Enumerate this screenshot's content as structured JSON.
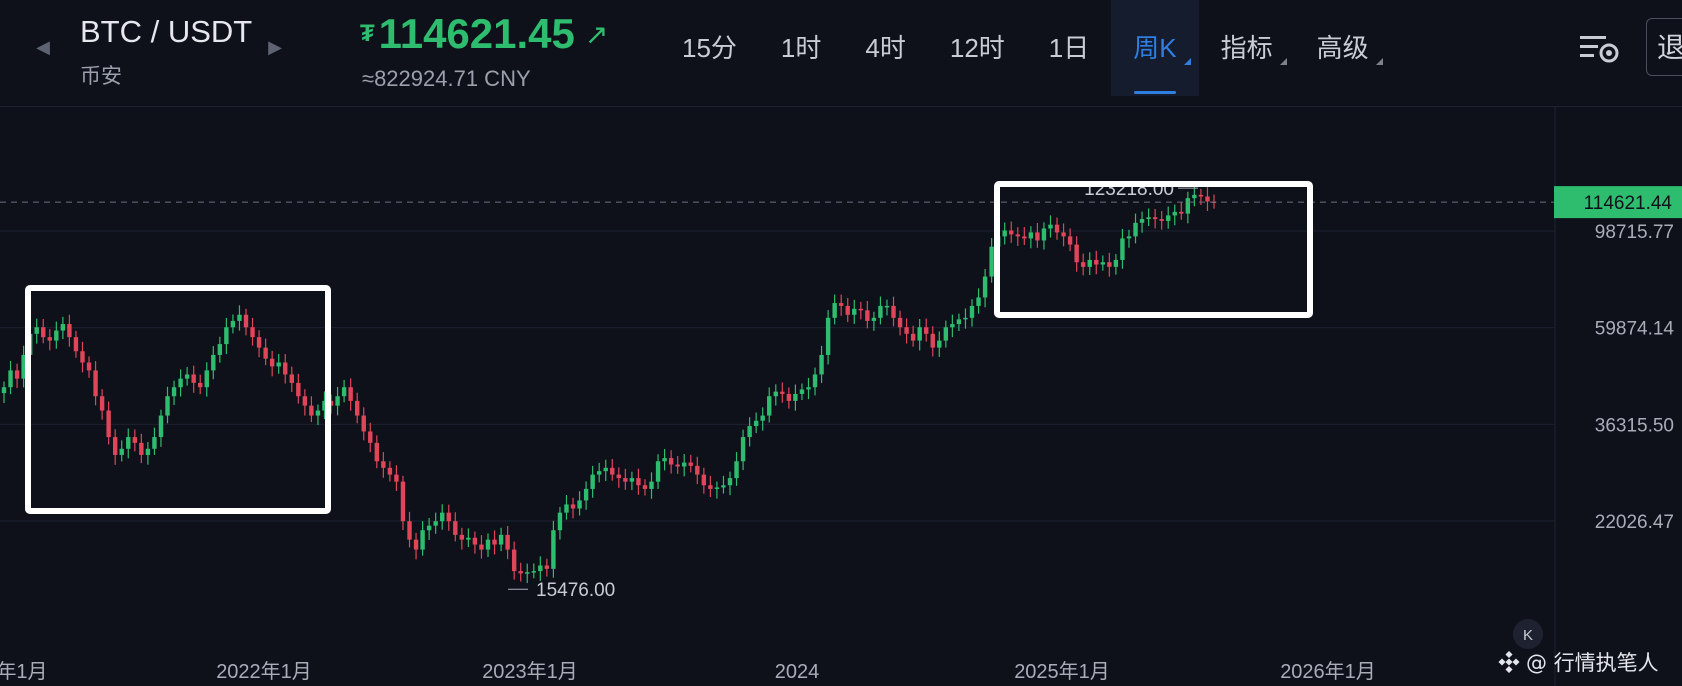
{
  "header": {
    "pair": "BTC / USDT",
    "exchange": "币安",
    "price": "114621.45",
    "currency_symbol": "₮",
    "trend_icon": "arrow-up-right-icon",
    "cny_value": "≈822924.71 CNY",
    "price_color": "#2ebd6e"
  },
  "tabs": [
    {
      "label": "15分",
      "active": false
    },
    {
      "label": "1时",
      "active": false
    },
    {
      "label": "4时",
      "active": false
    },
    {
      "label": "12时",
      "active": false
    },
    {
      "label": "1日",
      "active": false
    },
    {
      "label": "周K",
      "active": true,
      "dropdown": true
    },
    {
      "label": "指标",
      "active": false,
      "dropdown": true
    },
    {
      "label": "高级",
      "active": false,
      "dropdown": true
    }
  ],
  "toolbar": {
    "settings_icon": "chart-settings-icon",
    "exit_label": "退"
  },
  "chart_data": {
    "type": "candlestick",
    "interval": "周K",
    "y_scale": "log",
    "y_ticks": [
      "98715.77",
      "59874.14",
      "36315.50",
      "22026.47"
    ],
    "x_ticks": [
      "年1月",
      "2022年1月",
      "2023年1月",
      "2024",
      "2025年1月",
      "2026年1月"
    ],
    "current_price_label": "114621.44",
    "high_label": "123218.00",
    "low_label": "15476.00",
    "up_color": "#2ebd6e",
    "down_color": "#e0455a",
    "series_close": [
      44000,
      48000,
      46000,
      52000,
      58000,
      60000,
      57000,
      56000,
      59000,
      61000,
      57000,
      53000,
      50000,
      48000,
      42000,
      39000,
      34000,
      31000,
      32000,
      34000,
      33000,
      31000,
      32000,
      34000,
      38000,
      42000,
      44000,
      46000,
      47000,
      45000,
      44000,
      48000,
      52000,
      55000,
      60000,
      62000,
      64000,
      60000,
      57000,
      54000,
      51000,
      49000,
      50000,
      47000,
      45000,
      42000,
      40000,
      38000,
      39000,
      41000,
      40000,
      42000,
      44000,
      41000,
      38000,
      35000,
      33000,
      30000,
      29000,
      28000,
      27000,
      22000,
      20000,
      19000,
      21000,
      21500,
      22000,
      23000,
      22000,
      20500,
      20000,
      20200,
      19500,
      19000,
      20000,
      19500,
      20500,
      19000,
      17000,
      16800,
      16900,
      17000,
      17500,
      17200,
      21000,
      23000,
      24000,
      23500,
      24500,
      26000,
      28000,
      28500,
      29000,
      28000,
      27500,
      27000,
      27500,
      26500,
      26000,
      27000,
      30000,
      30500,
      29500,
      29200,
      29800,
      29300,
      28000,
      26500,
      26000,
      26200,
      26500,
      27500,
      30000,
      34000,
      36000,
      37000,
      38000,
      42000,
      43000,
      42500,
      41000,
      42500,
      43500,
      44000,
      47000,
      52000,
      63000,
      68000,
      67000,
      64000,
      66000,
      65500,
      62000,
      63000,
      67000,
      67000,
      63000,
      60000,
      58000,
      56000,
      60000,
      58000,
      54000,
      56000,
      60000,
      61000,
      62500,
      63000,
      67000,
      70000,
      78000,
      91000,
      96000,
      99000,
      97000,
      96000,
      95000,
      98000,
      94000,
      100000,
      102000,
      98000,
      96000,
      92000,
      84000,
      82000,
      85000,
      83000,
      84000,
      82000,
      85000,
      95000,
      96000,
      103000,
      105000,
      106000,
      105000,
      104000,
      107000,
      109000,
      108000,
      117000,
      119000,
      118000,
      115000,
      114621
    ]
  }
}
